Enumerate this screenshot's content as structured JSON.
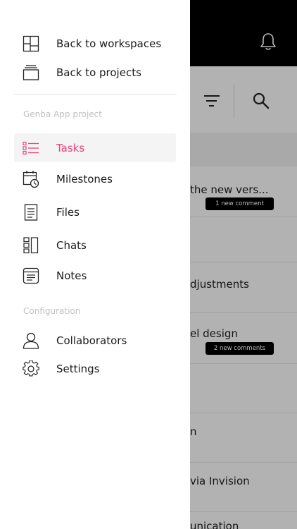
{
  "colors": {
    "accent": "#e8457a",
    "topbar": "#000000",
    "drawer_bg": "#ffffff",
    "text": "#1b1b1b",
    "muted": "#c2c2c2"
  },
  "drawer": {
    "back_to_workspaces": {
      "label": "Back to workspaces",
      "icon": "workspaces-icon"
    },
    "back_to_projects": {
      "label": "Back to projects",
      "icon": "projects-icon"
    },
    "project_section_label": "Genba App project",
    "project_items": [
      {
        "label": "Tasks",
        "icon": "tasks-icon",
        "active": true
      },
      {
        "label": "Milestones",
        "icon": "milestones-icon",
        "active": false
      },
      {
        "label": "Files",
        "icon": "files-icon",
        "active": false
      },
      {
        "label": "Chats",
        "icon": "chats-icon",
        "active": false
      },
      {
        "label": "Notes",
        "icon": "notes-icon",
        "active": false
      }
    ],
    "config_section_label": "Configuration",
    "config_items": [
      {
        "label": "Collaborators",
        "icon": "collaborators-icon"
      },
      {
        "label": "Settings",
        "icon": "settings-icon"
      }
    ]
  },
  "background": {
    "header_icons": [
      "bell-icon",
      "sort-icon",
      "search-icon"
    ],
    "rows": [
      {
        "text": "the new vers...",
        "badge": "1 new comment"
      },
      {
        "text": "",
        "badge": ""
      },
      {
        "text": "djustments",
        "badge": ""
      },
      {
        "text": "el design",
        "badge": "2 new comments"
      },
      {
        "text": "",
        "badge": ""
      },
      {
        "text": "n",
        "badge": ""
      },
      {
        "text": "via Invision",
        "badge": ""
      },
      {
        "text": "unication",
        "badge": ""
      }
    ]
  }
}
